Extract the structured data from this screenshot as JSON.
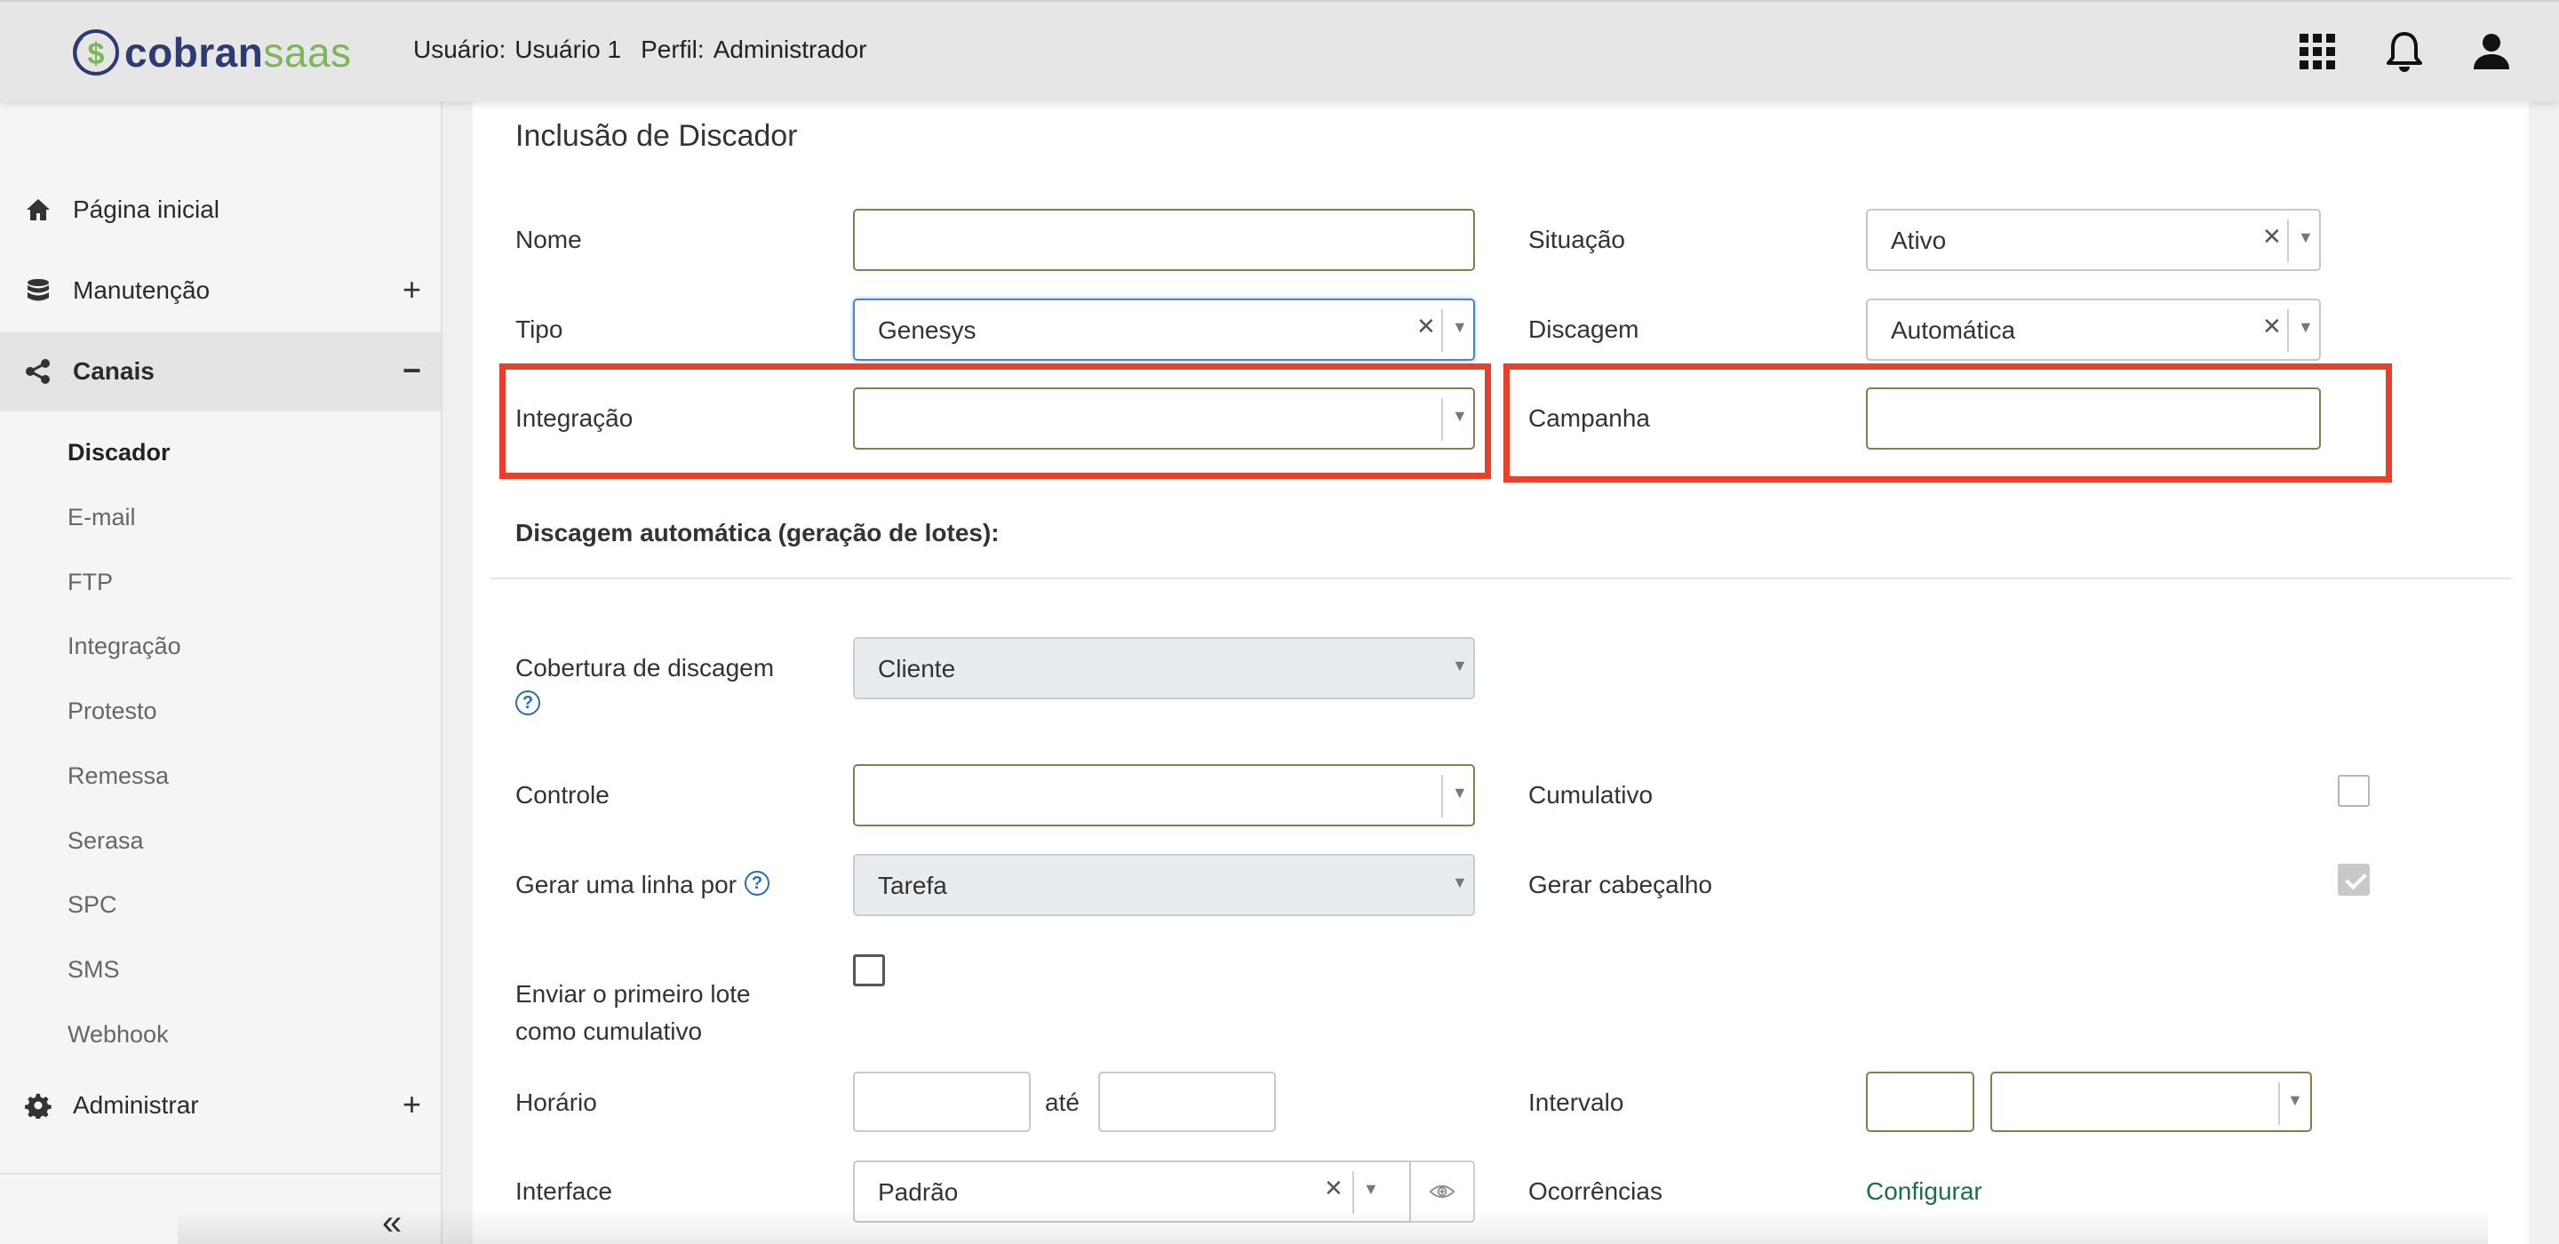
{
  "header": {
    "logo_text_a": "cobran",
    "logo_text_b": "saas",
    "user_label": "Usuário:",
    "user_value": "Usuário 1",
    "profile_label": "Perfil:",
    "profile_value": "Administrador",
    "icons": [
      "apps-grid-icon",
      "bell-icon",
      "user-icon"
    ]
  },
  "sidebar": {
    "items": [
      {
        "label": "Página inicial",
        "icon": "home-icon",
        "toggle": ""
      },
      {
        "label": "Manutenção",
        "icon": "database-icon",
        "toggle": "+"
      },
      {
        "label": "Canais",
        "icon": "share-icon",
        "toggle": "−"
      },
      {
        "label": "Administrar",
        "icon": "gear-icon",
        "toggle": "+"
      }
    ],
    "subitems": [
      "Discador",
      "E-mail",
      "FTP",
      "Integração",
      "Protesto",
      "Remessa",
      "Serasa",
      "SPC",
      "SMS",
      "Webhook"
    ],
    "collapse": "«"
  },
  "form": {
    "title": "Inclusão de Discador",
    "nome": {
      "label": "Nome",
      "value": ""
    },
    "situacao": {
      "label": "Situação",
      "value": "Ativo"
    },
    "tipo": {
      "label": "Tipo",
      "value": "Genesys"
    },
    "discagem": {
      "label": "Discagem",
      "value": "Automática"
    },
    "integracao": {
      "label": "Integração",
      "value": ""
    },
    "campanha": {
      "label": "Campanha",
      "value": ""
    },
    "section_title": "Discagem automática (geração de lotes):",
    "cobertura": {
      "label": "Cobertura de discagem",
      "value": "Cliente"
    },
    "controle": {
      "label": "Controle",
      "value": ""
    },
    "cumulativo": {
      "label": "Cumulativo",
      "checked": false
    },
    "gerar_linha": {
      "label": "Gerar uma linha por",
      "value": "Tarefa"
    },
    "gerar_cabecalho": {
      "label": "Gerar cabeçalho",
      "checked": true
    },
    "enviar_primeiro": {
      "label_line1": "Enviar o primeiro lote",
      "label_line2": "como cumulativo",
      "checked": false
    },
    "horario": {
      "label": "Horário",
      "ate": "até",
      "from": "",
      "to": ""
    },
    "intervalo": {
      "label": "Intervalo",
      "value": "",
      "unit": ""
    },
    "interface": {
      "label": "Interface",
      "value": "Padrão"
    },
    "ocorrencias": {
      "label": "Ocorrências",
      "link": "Configurar"
    }
  },
  "colors": {
    "highlight": "#e8402a",
    "link": "#1f6b4a",
    "brand_dark": "#2e3b73",
    "brand_green": "#7cb55c"
  }
}
